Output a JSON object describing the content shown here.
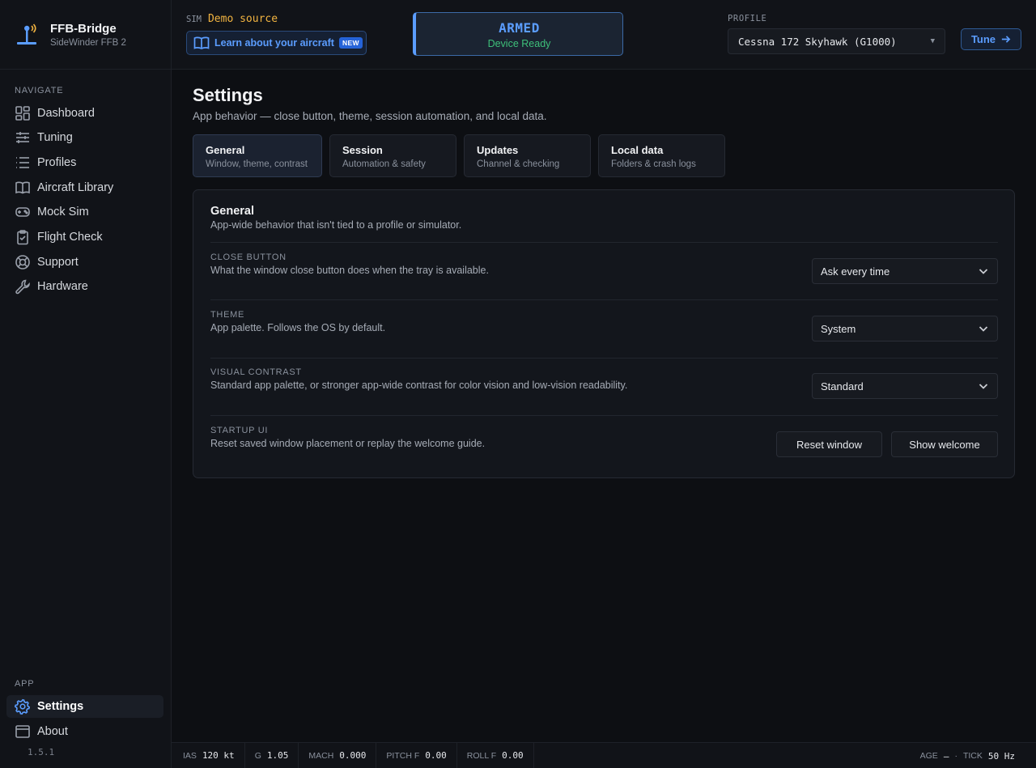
{
  "brand": {
    "name": "FFB-Bridge",
    "device": "SideWinder FFB 2",
    "icon": "joystick-icon"
  },
  "sidebar": {
    "navigate_label": "NAVIGATE",
    "items": [
      {
        "label": "Dashboard",
        "icon": "dashboard-icon"
      },
      {
        "label": "Tuning",
        "icon": "sliders-icon"
      },
      {
        "label": "Profiles",
        "icon": "list-icon"
      },
      {
        "label": "Aircraft Library",
        "icon": "book-icon"
      },
      {
        "label": "Mock Sim",
        "icon": "gamepad-icon"
      },
      {
        "label": "Flight Check",
        "icon": "clipboard-icon"
      },
      {
        "label": "Support",
        "icon": "lifebuoy-icon"
      },
      {
        "label": "Hardware",
        "icon": "wrench-icon"
      }
    ],
    "app_label": "APP",
    "app_items": [
      {
        "label": "Settings",
        "icon": "gear-icon",
        "active": true
      },
      {
        "label": "About",
        "icon": "window-icon"
      }
    ],
    "version": "1.5.1"
  },
  "header": {
    "sim_tag": "SIM",
    "sim_source": "Demo source",
    "learn_label": "Learn about your aircraft",
    "new_badge": "NEW",
    "status_title": "ARMED",
    "status_sub": "Device Ready",
    "profile_label": "PROFILE",
    "profile_value": "Cessna 172 Skyhawk (G1000)",
    "tune_label": "Tune"
  },
  "page": {
    "title": "Settings",
    "subtitle": "App behavior — close button, theme, session automation, and local data.",
    "tabs": [
      {
        "title": "General",
        "sub": "Window, theme, contrast",
        "active": true
      },
      {
        "title": "Session",
        "sub": "Automation & safety"
      },
      {
        "title": "Updates",
        "sub": "Channel & checking"
      },
      {
        "title": "Local data",
        "sub": "Folders & crash logs"
      }
    ]
  },
  "panel": {
    "title": "General",
    "subtitle": "App-wide behavior that isn't tied to a profile or simulator.",
    "rows": [
      {
        "label": "CLOSE BUTTON",
        "desc": "What the window close button does when the tray is available.",
        "value": "Ask every time"
      },
      {
        "label": "THEME",
        "desc": "App palette. Follows the OS by default.",
        "value": "System"
      },
      {
        "label": "VISUAL CONTRAST",
        "desc": "Standard app palette, or stronger app-wide contrast for color vision and low-vision readability.",
        "value": "Standard"
      },
      {
        "label": "STARTUP UI",
        "desc": "Reset saved window placement or replay the welcome guide.",
        "buttons": [
          "Reset window",
          "Show welcome"
        ]
      }
    ]
  },
  "statusbar": {
    "ias_label": "IAS",
    "ias_value": "120 kt",
    "g_label": "G",
    "g_value": "1.05",
    "mach_label": "MACH",
    "mach_value": "0.000",
    "pitch_label": "PITCH F",
    "pitch_value": "0.00",
    "roll_label": "ROLL F",
    "roll_value": "0.00",
    "age_label": "AGE",
    "age_value": "—",
    "sep": "·",
    "tick_label": "TICK",
    "tick_value": "50 Hz"
  },
  "colors": {
    "accent": "#5b9dff",
    "warning": "#f2b441",
    "success": "#3ec07a",
    "background": "#0d0f13"
  }
}
